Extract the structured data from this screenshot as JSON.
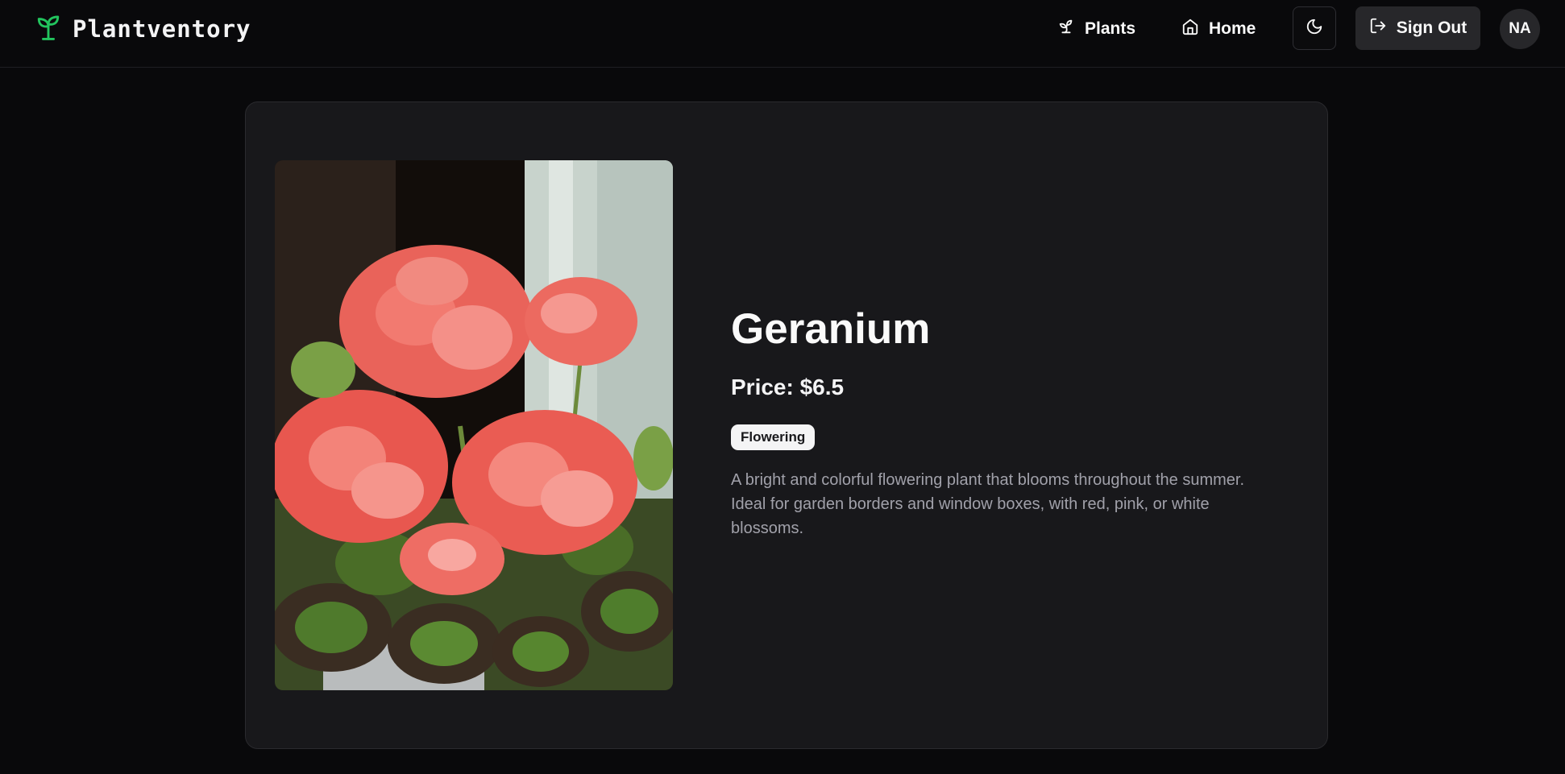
{
  "header": {
    "brand": "Plantventory",
    "brand_icon": "sprout-icon",
    "nav": {
      "plants_label": "Plants",
      "home_label": "Home"
    },
    "theme_toggle_icon": "moon-icon",
    "sign_out_label": "Sign Out",
    "avatar_initials": "NA"
  },
  "plant": {
    "name": "Geranium",
    "price": "Price: $6.5",
    "category": "Flowering",
    "description": "A bright and colorful flowering plant that blooms throughout the summer. Ideal for garden borders and window boxes, with red, pink, or white blossoms.",
    "image_alt": "Geranium"
  },
  "colors": {
    "background": "#09090b",
    "card": "#18181b",
    "brand_accent": "#22c55e",
    "muted_text": "#a1a1aa"
  }
}
